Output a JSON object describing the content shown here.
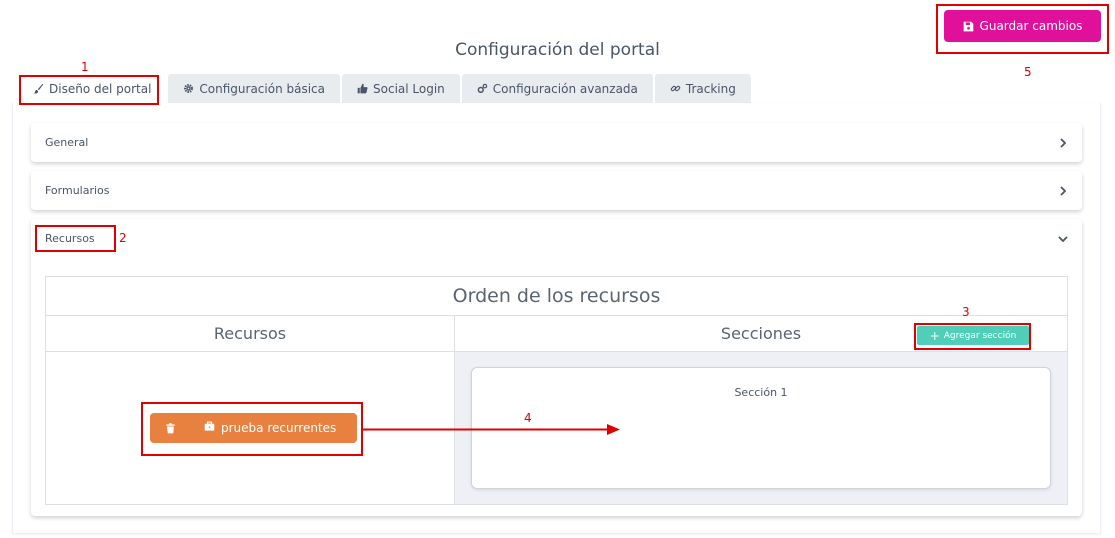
{
  "header": {
    "save_label": "Guardar cambios",
    "title": "Configuración del portal"
  },
  "tabs": [
    {
      "label": "Diseño del portal",
      "icon": "brush-icon",
      "active": true
    },
    {
      "label": "Configuración básica",
      "icon": "gear-icon",
      "active": false
    },
    {
      "label": "Social Login",
      "icon": "thumbs-up-icon",
      "active": false
    },
    {
      "label": "Configuración avanzada",
      "icon": "gears-icon",
      "active": false
    },
    {
      "label": "Tracking",
      "icon": "link-icon",
      "active": false
    }
  ],
  "accordion": {
    "general": "General",
    "formularios": "Formularios",
    "recursos": "Recursos"
  },
  "resources_order": {
    "title": "Orden de los recursos",
    "col_resources": "Recursos",
    "col_sections": "Secciones",
    "add_section_label": "Agregar sección",
    "resource_item": "prueba recurrentes",
    "section_title": "Sección 1"
  },
  "annotations": [
    "1",
    "2",
    "3",
    "4",
    "5"
  ],
  "colors": {
    "primary": "#e0109a",
    "accent_teal": "#4fcfb8",
    "resource_orange": "#e8803f",
    "annotation_red": "#e00000"
  }
}
